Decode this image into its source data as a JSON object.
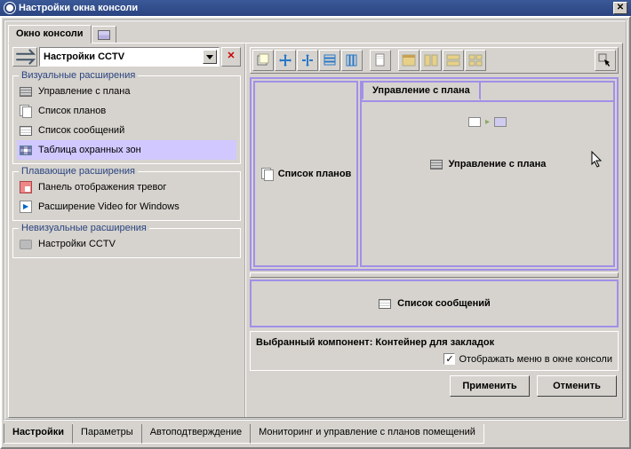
{
  "titlebar": {
    "title": "Настройки окна консоли"
  },
  "top_tabs": {
    "console_window": "Окно консоли"
  },
  "sidebar": {
    "selector_label": "Настройки CCTV",
    "groups": {
      "visual": {
        "legend": "Визуальные расширения",
        "items": [
          {
            "label": "Управление с плана"
          },
          {
            "label": "Список планов"
          },
          {
            "label": "Список сообщений"
          },
          {
            "label": "Таблица охранных зон"
          }
        ]
      },
      "floating": {
        "legend": "Плавающие расширения",
        "items": [
          {
            "label": "Панель отображения тревог"
          },
          {
            "label": "Расширение Video for Windows"
          }
        ]
      },
      "nonvisual": {
        "legend": "Невизуальные расширения",
        "items": [
          {
            "label": "Настройки CCTV"
          }
        ]
      }
    }
  },
  "preview": {
    "left_label": "Список планов",
    "tab_label": "Управление с плана",
    "center_label": "Управление с плана",
    "bottom_label": "Список сообщений"
  },
  "info": {
    "selected_component": "Выбранный компонент: Контейнер для закладок",
    "checkbox_label": "Отображать меню в окне консоли"
  },
  "buttons": {
    "apply": "Применить",
    "cancel": "Отменить"
  },
  "bottom_tabs": {
    "settings": "Настройки",
    "params": "Параметры",
    "autoconfirm": "Автоподтверждение",
    "monitoring": "Мониторинг и управление с планов помещений"
  }
}
